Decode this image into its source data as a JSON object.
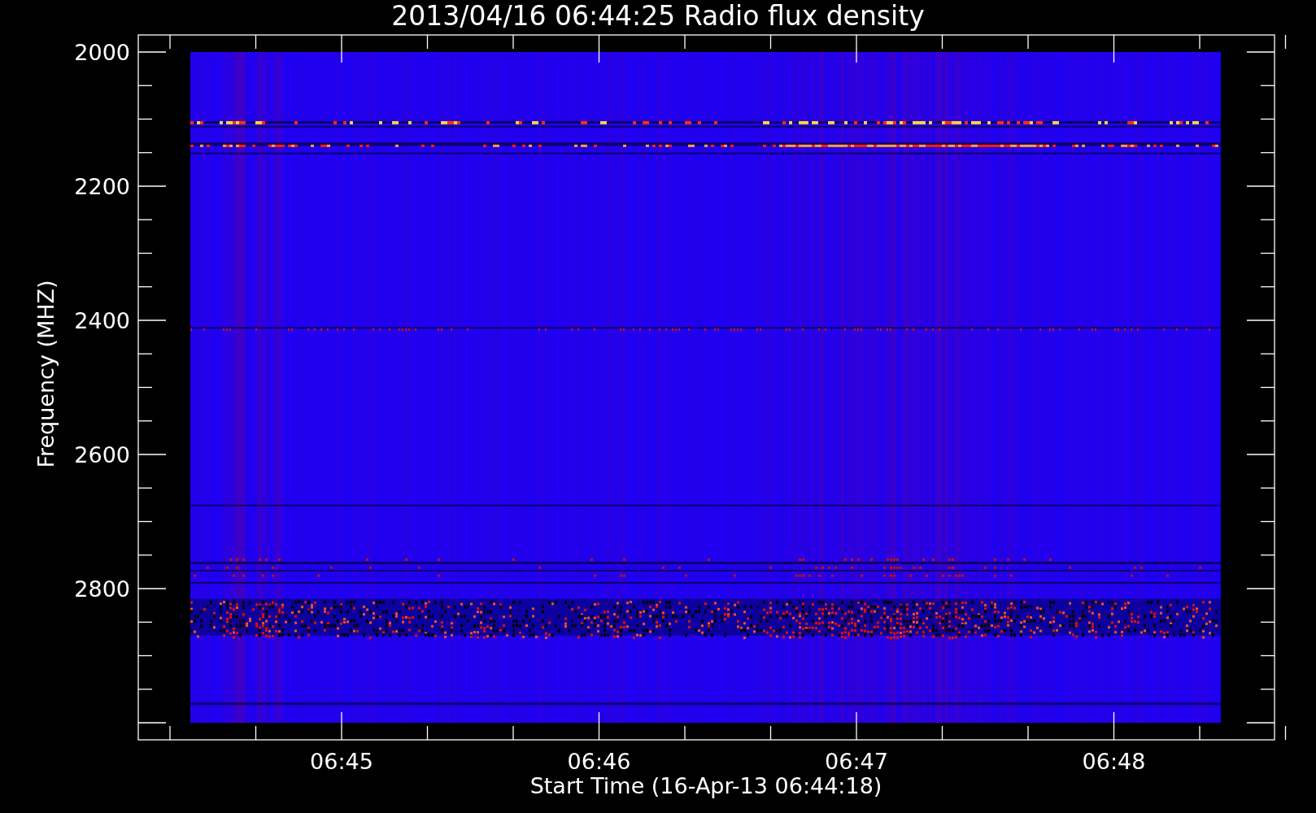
{
  "plot": {
    "title": "2013/04/16 06:44:25 Radio flux density",
    "ylabel": "Frequency (MHZ)",
    "xlabel": "Start Time (16-Apr-13 06:44:18)",
    "yticks": [
      "2000",
      "2200",
      "2400",
      "2600",
      "2800"
    ],
    "xticks": [
      "06:45",
      "06:46",
      "06:47",
      "06:48"
    ]
  }
}
